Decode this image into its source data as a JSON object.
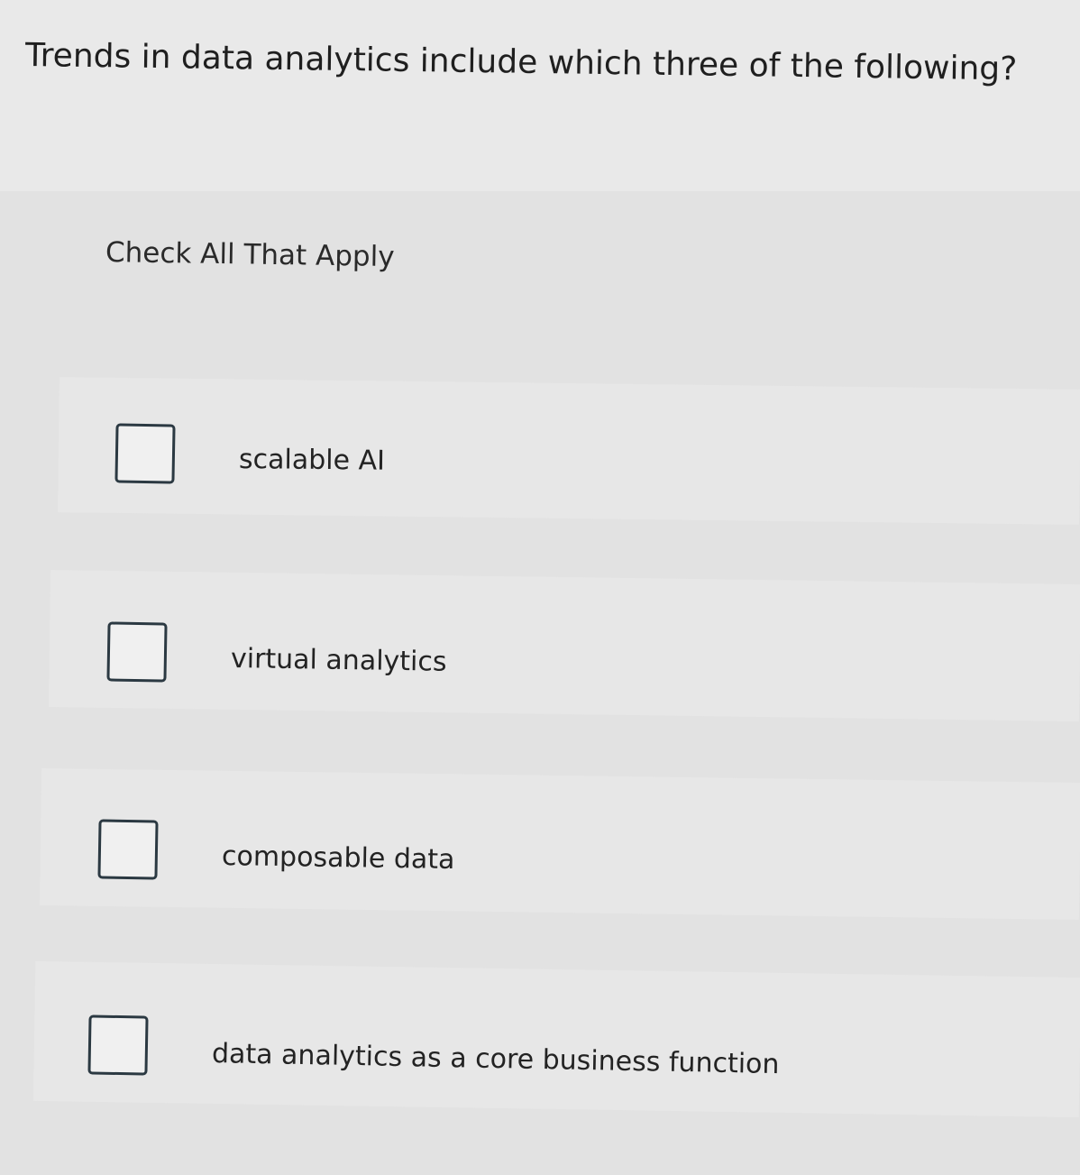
{
  "question": {
    "text": "Trends in data analytics include which three of the following?"
  },
  "instruction": {
    "text": "Check All That Apply"
  },
  "options": [
    {
      "label": "scalable AI",
      "checked": false
    },
    {
      "label": "virtual analytics",
      "checked": false
    },
    {
      "label": "composable data",
      "checked": false
    },
    {
      "label": "data analytics as a core business function",
      "checked": false
    }
  ]
}
